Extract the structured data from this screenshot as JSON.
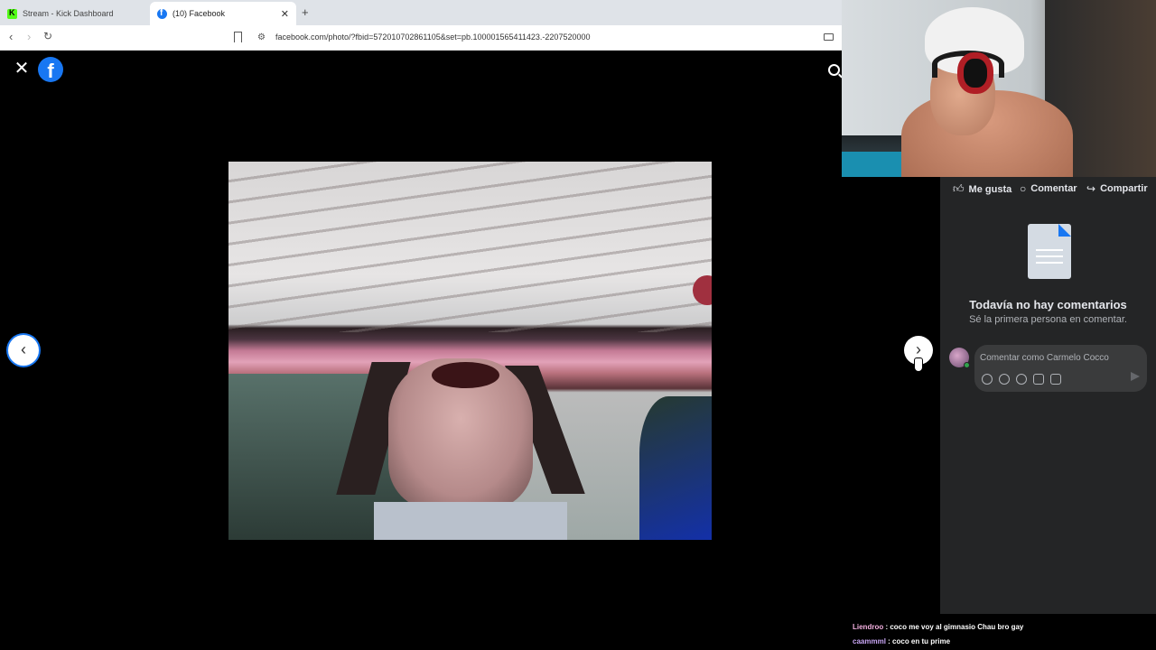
{
  "browser": {
    "tabs": [
      {
        "title": "Stream - Kick Dashboard",
        "active": false
      },
      {
        "title": "(10) Facebook",
        "active": true
      }
    ],
    "new_tab": "+",
    "tab_close": "✕",
    "url": "facebook.com/photo/?fbid=572010702861105&set=pb.100001565411423.-2207520000"
  },
  "viewer": {
    "close": "✕",
    "logo": "f",
    "prev": "‹",
    "next": "›"
  },
  "panel": {
    "actions": {
      "like": "Me gusta",
      "comment": "Comentar",
      "share": "Compartir"
    },
    "empty_title": "Todavía no hay comentarios",
    "empty_subtitle": "Sé la primera persona en comentar.",
    "comment_placeholder": "Comentar como Carmelo Cocco"
  },
  "chat": [
    {
      "user": "Liendroo",
      "message": " : coco me voy al gimnasio Chau bro gay"
    },
    {
      "user": "caammml",
      "message": " : coco en tu prime"
    }
  ],
  "colors": {
    "facebook_blue": "#1877f2",
    "panel_bg": "#242526",
    "kick_green": "#53fc18"
  }
}
